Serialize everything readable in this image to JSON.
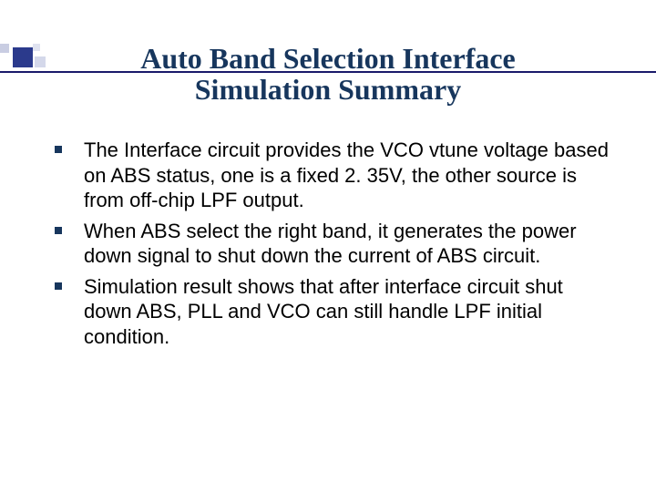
{
  "title_line1": "Auto Band Selection Interface",
  "title_line2": "Simulation Summary",
  "bullets": [
    "The Interface circuit provides the VCO vtune voltage based on ABS status, one is a fixed 2. 35V, the other source is from off-chip LPF output.",
    "When ABS select the right band, it generates the power down signal to shut down the current of ABS circuit.",
    "Simulation result shows that after interface circuit shut down ABS, PLL and VCO can still handle LPF initial condition."
  ]
}
